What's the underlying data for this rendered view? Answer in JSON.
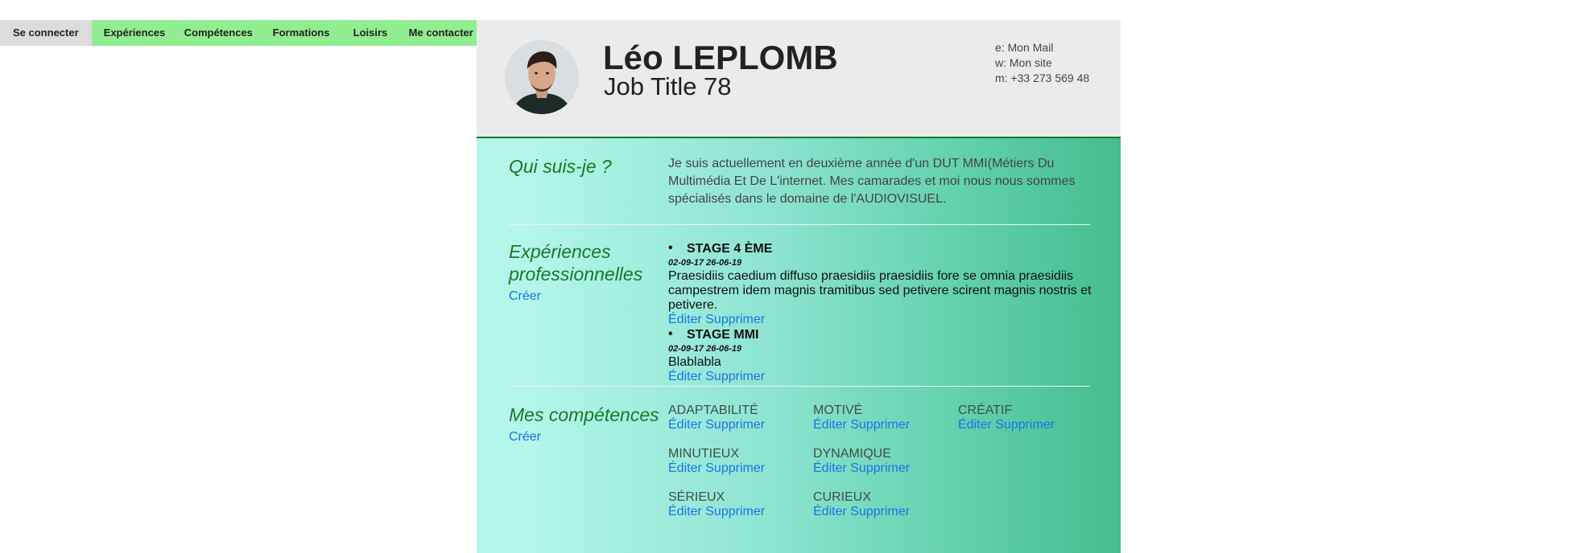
{
  "nav": {
    "items": [
      {
        "label": "Se connecter"
      },
      {
        "label": "Expériences"
      },
      {
        "label": "Compétences"
      },
      {
        "label": "Formations"
      },
      {
        "label": "Loisirs"
      },
      {
        "label": "Me contacter"
      }
    ]
  },
  "header": {
    "name": "Léo LEPLOMB",
    "job_title": "Job Title 78",
    "contact": {
      "mail": "e: Mon Mail",
      "site": "w: Mon site",
      "phone": "m: +33 273 569 48"
    }
  },
  "about": {
    "title": "Qui suis-je ?",
    "text": "Je suis actuellement en deuxième année d'un DUT MMI(Métiers Du Multimédia Et De L'internet. Mes camarades et moi nous nous sommes spécialisés dans le domaine de l'AUDIOVISUEL."
  },
  "experiences": {
    "title": "Expériences professionnelles",
    "create_label": "Créer",
    "items": [
      {
        "title": "STAGE 4 ÈME",
        "dates": "02-09-17 26-06-19",
        "description": "Praesidiis caedium diffuso praesidiis praesidiis fore se omnia praesidiis campestrem idem magnis tramitibus sed petivere scirent magnis nostris et petivere.",
        "edit_label": "Éditer",
        "delete_label": "Supprimer"
      },
      {
        "title": "STAGE MMI",
        "dates": "02-09-17 26-06-19",
        "description": "Blablabla",
        "edit_label": "Éditer",
        "delete_label": "Supprimer"
      }
    ]
  },
  "skills": {
    "title": "Mes compétences",
    "create_label": "Créer",
    "edit_label": "Éditer",
    "delete_label": "Supprimer",
    "items": [
      {
        "name": "ADAPTABILITÉ"
      },
      {
        "name": "MOTIVÉ"
      },
      {
        "name": "CRÉATIF"
      },
      {
        "name": "MINUTIEUX"
      },
      {
        "name": "DYNAMIQUE"
      },
      {
        "name": "SÉRIEUX"
      },
      {
        "name": "CURIEUX"
      }
    ]
  },
  "colors": {
    "nav_active": "#dcdcdc",
    "nav_item": "#90ee90",
    "section_title": "#177a27",
    "link": "#1a73e8",
    "header_border": "#157a2a"
  }
}
